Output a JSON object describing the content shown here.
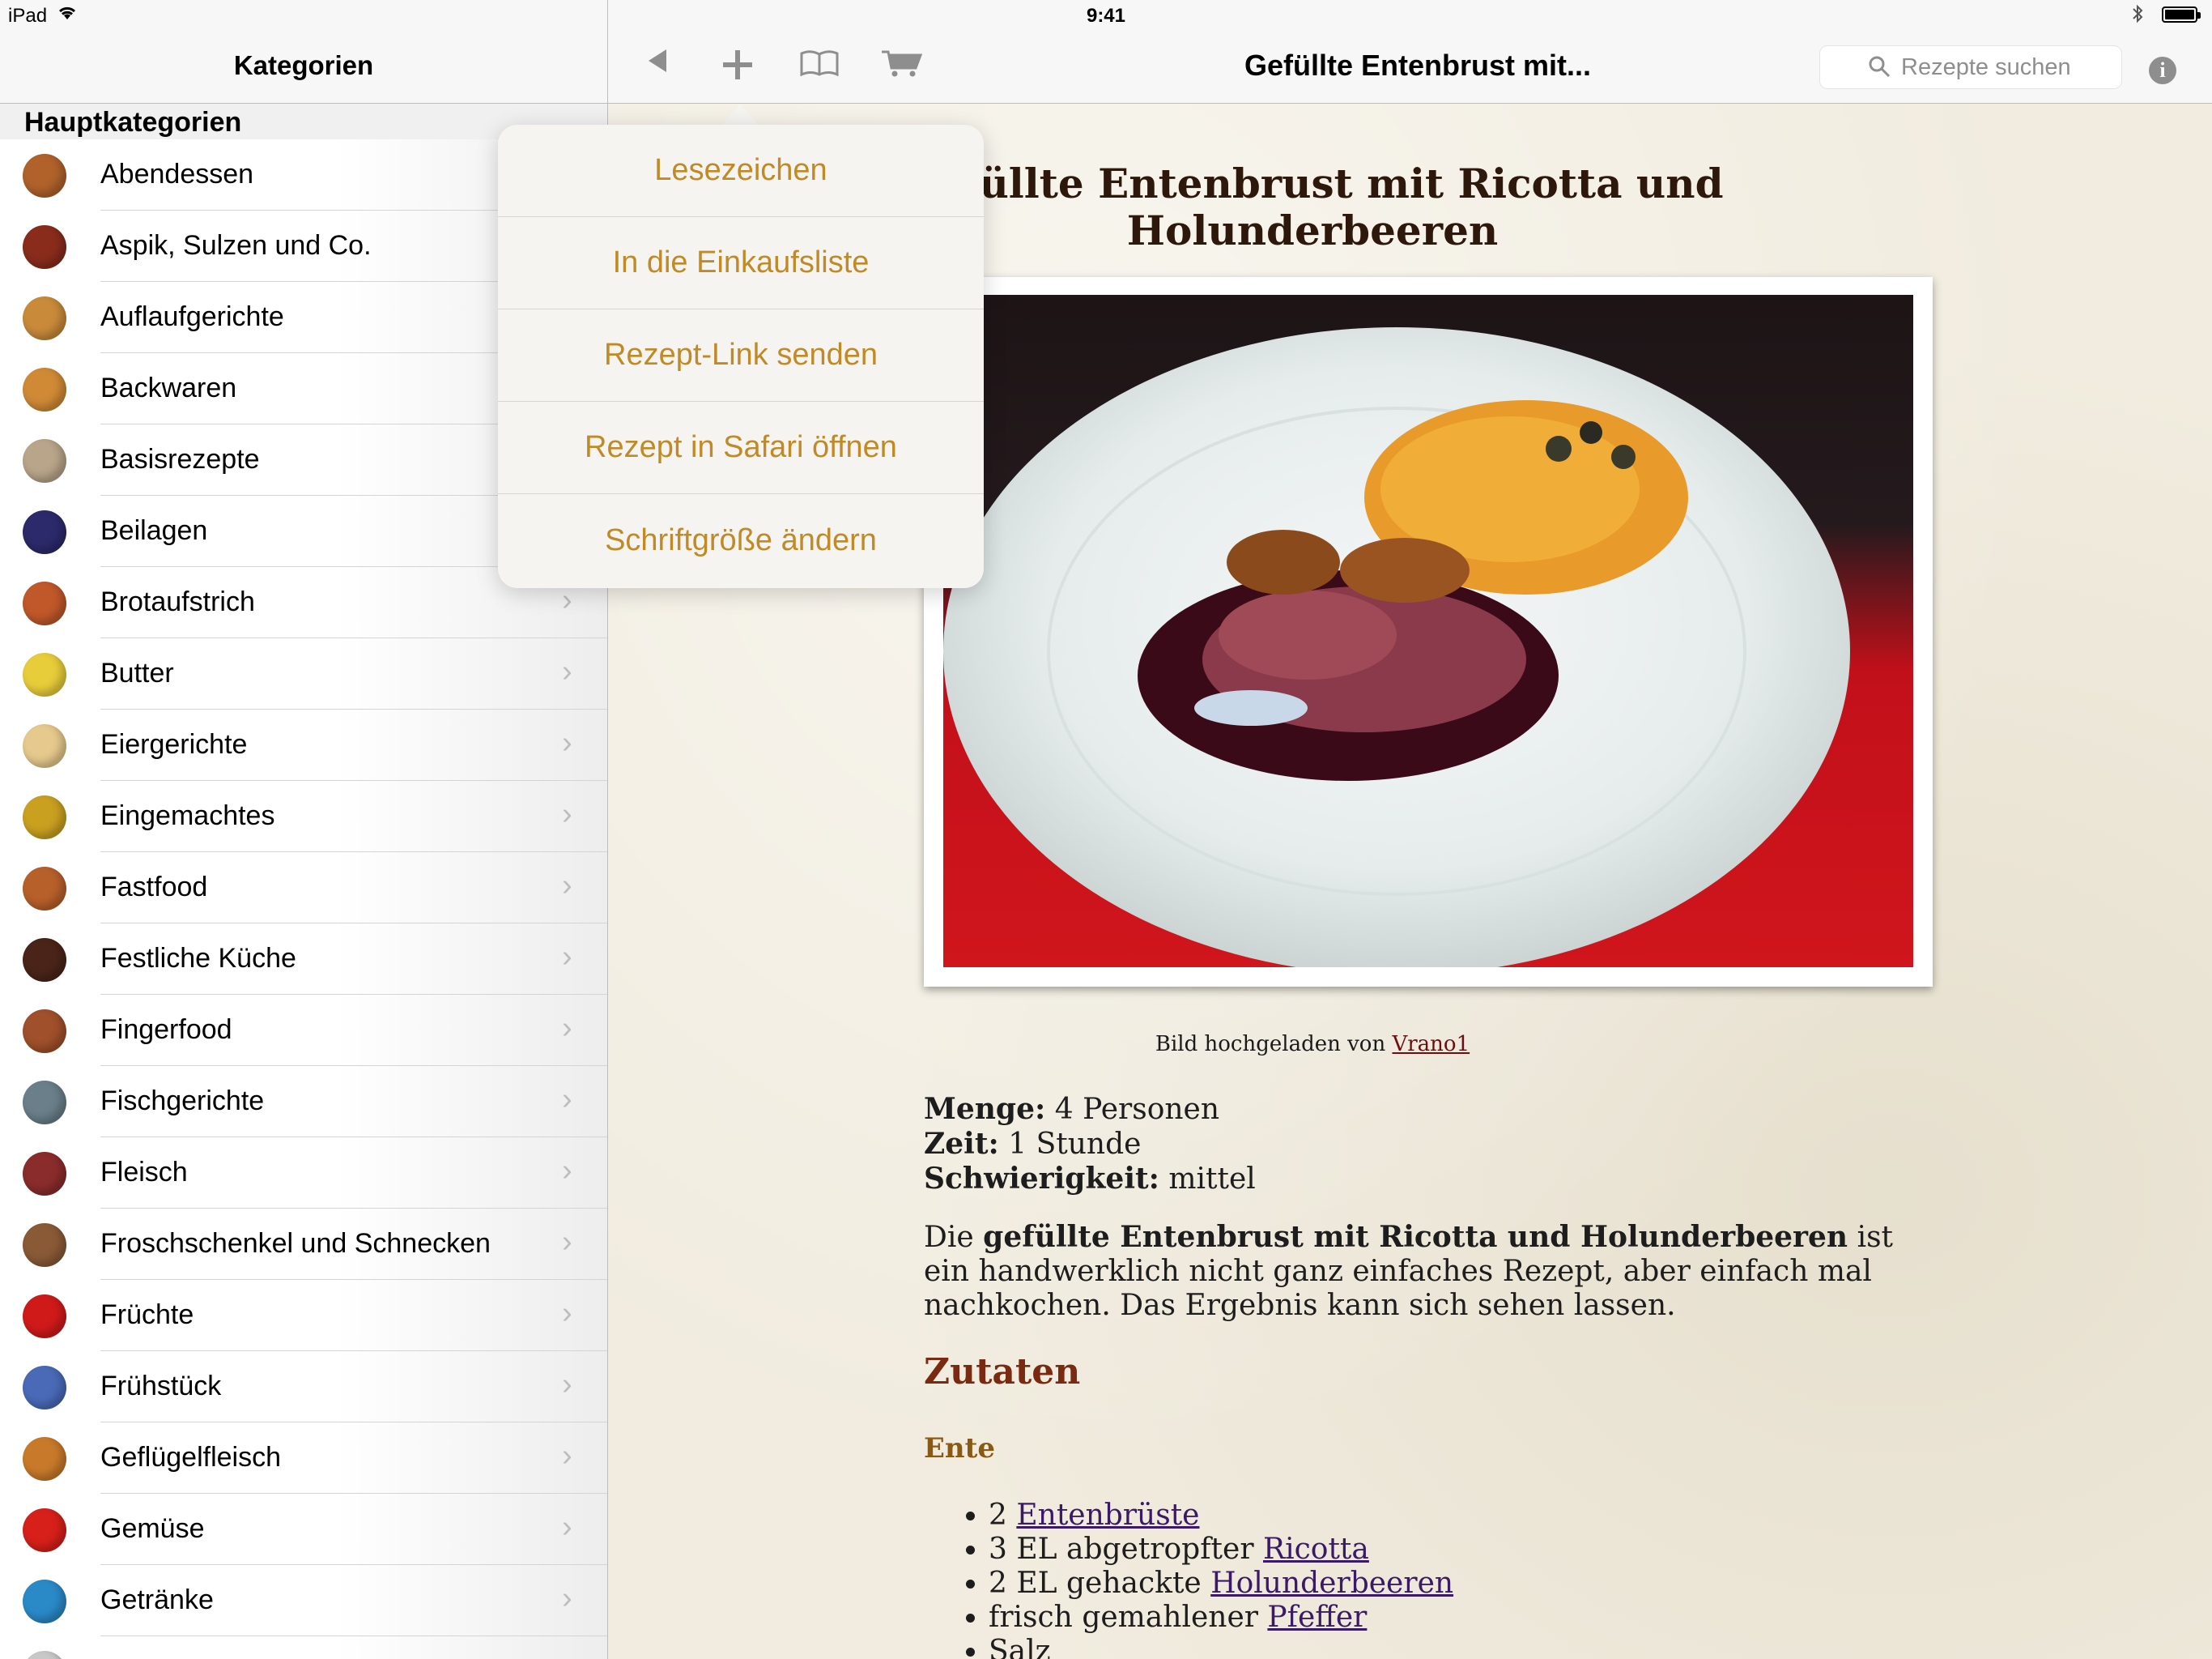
{
  "status_bar": {
    "device": "iPad",
    "time": "9:41",
    "battery_level": 1.0
  },
  "sidebar": {
    "title": "Kategorien",
    "section": "Hauptkategorien",
    "items": [
      {
        "label": "Abendessen",
        "icon": "roast-dish-icon",
        "color": "#b0622a"
      },
      {
        "label": "Aspik, Sulzen und Co.",
        "icon": "aspic-icon",
        "color": "#8a2c1c"
      },
      {
        "label": "Auflaufgerichte",
        "icon": "casserole-icon",
        "color": "#c98a3a"
      },
      {
        "label": "Backwaren",
        "icon": "bread-icon",
        "color": "#d08a36"
      },
      {
        "label": "Basisrezepte",
        "icon": "magnifier-icon",
        "color": "#b8a58a"
      },
      {
        "label": "Beilagen",
        "icon": "side-dish-bowl-icon",
        "color": "#2c2a6a"
      },
      {
        "label": "Brotaufstrich",
        "icon": "toast-icon",
        "color": "#c0582a"
      },
      {
        "label": "Butter",
        "icon": "butter-icon",
        "color": "#e8cd3a"
      },
      {
        "label": "Eiergerichte",
        "icon": "egg-icon",
        "color": "#e6c98c"
      },
      {
        "label": "Eingemachtes",
        "icon": "jar-icon",
        "color": "#c9a020"
      },
      {
        "label": "Fastfood",
        "icon": "burger-icon",
        "color": "#b8602a"
      },
      {
        "label": "Festliche Küche",
        "icon": "cake-icon",
        "color": "#4a2418"
      },
      {
        "label": "Fingerfood",
        "icon": "sandwich-icon",
        "color": "#a0502a"
      },
      {
        "label": "Fischgerichte",
        "icon": "fish-icon",
        "color": "#6a7f8a"
      },
      {
        "label": "Fleisch",
        "icon": "meat-icon",
        "color": "#8a2c2c"
      },
      {
        "label": "Froschschenkel und Schnecken",
        "icon": "snail-icon",
        "color": "#8a5a36"
      },
      {
        "label": "Früchte",
        "icon": "apple-icon",
        "color": "#d01a1a"
      },
      {
        "label": "Frühstück",
        "icon": "breakfast-icon",
        "color": "#4a6ab8"
      },
      {
        "label": "Geflügelfleisch",
        "icon": "poultry-icon",
        "color": "#c87a2a"
      },
      {
        "label": "Gemüse",
        "icon": "pepper-icon",
        "color": "#d8201a"
      },
      {
        "label": "Getränke",
        "icon": "cocktail-icon",
        "color": "#2a8ac8"
      },
      {
        "label": "",
        "icon": "next-category-icon",
        "color": "#c8c8c8"
      }
    ]
  },
  "toolbar": {
    "title": "Gefüllte Entenbrust mit...",
    "search_placeholder": "Rezepte suchen"
  },
  "popover": {
    "items": [
      "Lesezeichen",
      "In die Einkaufsliste",
      "Rezept-Link senden",
      "Rezept in Safari öffnen",
      "Schriftgröße ändern"
    ]
  },
  "recipe": {
    "title": "Gefüllte Entenbrust mit Ricotta und Holunderbeeren",
    "caption_prefix": "Bild hochgeladen von",
    "caption_user": "Vrano1",
    "menge_label": "Menge:",
    "menge_value": "4 Personen",
    "zeit_label": "Zeit:",
    "zeit_value": "1 Stunde",
    "schwierigkeit_label": "Schwierigkeit:",
    "schwierigkeit_value": "mittel",
    "intro_prefix": "Die",
    "intro_bold": "gefüllte Entenbrust mit Ricotta und Holunderbeeren",
    "intro_rest": "ist ein handwerklich nicht ganz einfaches Rezept, aber einfach mal nachkochen. Das Ergebnis kann sich sehen lassen.",
    "zutaten_heading": "Zutaten",
    "group_heading": "Ente",
    "ingredients": [
      {
        "text": "2",
        "link": "Entenbrüste"
      },
      {
        "text": "3 EL abgetropfter",
        "link": "Ricotta"
      },
      {
        "text": "2 EL gehackte",
        "link": "Holunderbeeren"
      },
      {
        "text": "frisch gemahlener",
        "link": "Pfeffer"
      },
      {
        "text": "Salz",
        "link": ""
      }
    ]
  }
}
